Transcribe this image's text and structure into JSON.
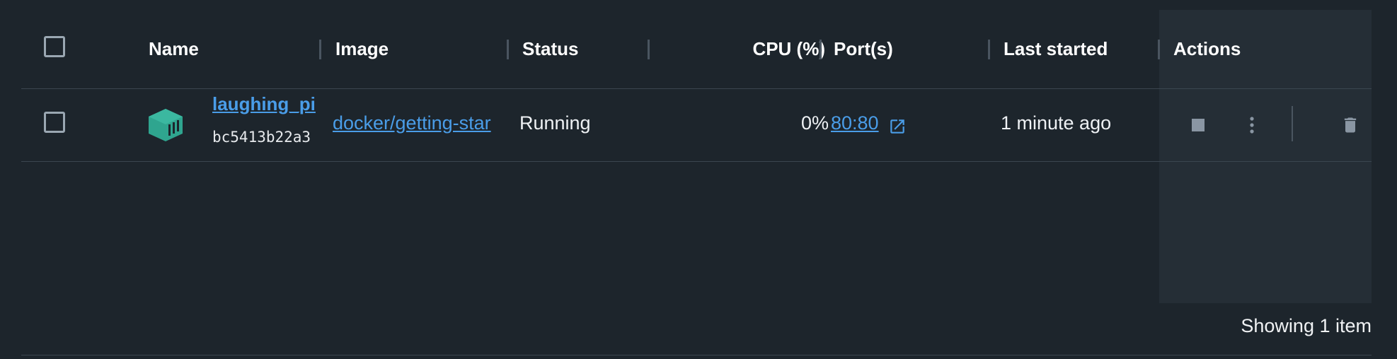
{
  "table": {
    "columns": {
      "name": "Name",
      "image": "Image",
      "status": "Status",
      "cpu": "CPU (%)",
      "ports": "Port(s)",
      "last_started": "Last started",
      "actions": "Actions"
    },
    "rows": [
      {
        "name": "laughing_pi",
        "id": "bc5413b22a3",
        "image": "docker/getting-star",
        "status": "Running",
        "cpu": "0%",
        "port": "80:80",
        "last_started": "1 minute ago",
        "checked": false,
        "icon": "container-icon"
      }
    ],
    "footer": "Showing 1 item"
  },
  "colors": {
    "background": "#1d252c",
    "actions_panel": "#252e36",
    "link": "#4a9de8",
    "container_icon": "#2fa58f",
    "checkbox_border": "#9aa7b2"
  },
  "icons": {
    "stop": "stop-icon",
    "more": "more-vertical-icon",
    "delete": "trash-icon",
    "external_link": "external-link-icon"
  }
}
